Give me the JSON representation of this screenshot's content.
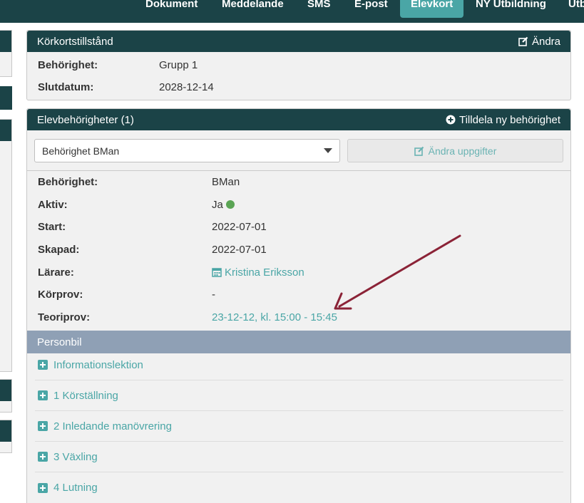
{
  "nav": {
    "tabs": [
      {
        "label": "Dokument",
        "active": false
      },
      {
        "label": "Meddelande",
        "active": false
      },
      {
        "label": "SMS",
        "active": false
      },
      {
        "label": "E-post",
        "active": false
      },
      {
        "label": "Elevkort",
        "active": true
      },
      {
        "label": "NY Utbildning",
        "active": false
      },
      {
        "label": "Utb",
        "active": false
      }
    ]
  },
  "license": {
    "title": "Körkortstillstånd",
    "edit_label": "Ändra",
    "fields": [
      {
        "label": "Behörighet:",
        "value": "Grupp 1"
      },
      {
        "label": "Slutdatum:",
        "value": "2028-12-14"
      }
    ]
  },
  "student_auth": {
    "title": "Elevbehörigheter (1)",
    "add_label": "Tilldela ny behörighet",
    "select_value": "Behörighet BMan",
    "edit_button": "Ändra uppgifter",
    "fields": [
      {
        "label": "Behörighet:",
        "value": "BMan"
      },
      {
        "label": "Aktiv:",
        "value": "Ja"
      },
      {
        "label": "Start:",
        "value": "2022-07-01"
      },
      {
        "label": "Skapad:",
        "value": "2022-07-01"
      },
      {
        "label": "Lärare:",
        "value": "Kristina Eriksson"
      },
      {
        "label": "Körprov:",
        "value": "-"
      },
      {
        "label": "Teoriprov:",
        "value": "23-12-12, kl. 15:00 - 15:45"
      }
    ],
    "section_title": "Personbil",
    "lessons": [
      "Informationslektion",
      "1 Körställning",
      "2 Inledande manövrering",
      "3 Växling",
      "4 Lutning"
    ]
  },
  "colors": {
    "header_bg": "#1b4347",
    "accent": "#4aa6a6",
    "section_bg": "#8fa0b5",
    "active_dot": "#5aa454",
    "arrow": "#8b2337"
  }
}
